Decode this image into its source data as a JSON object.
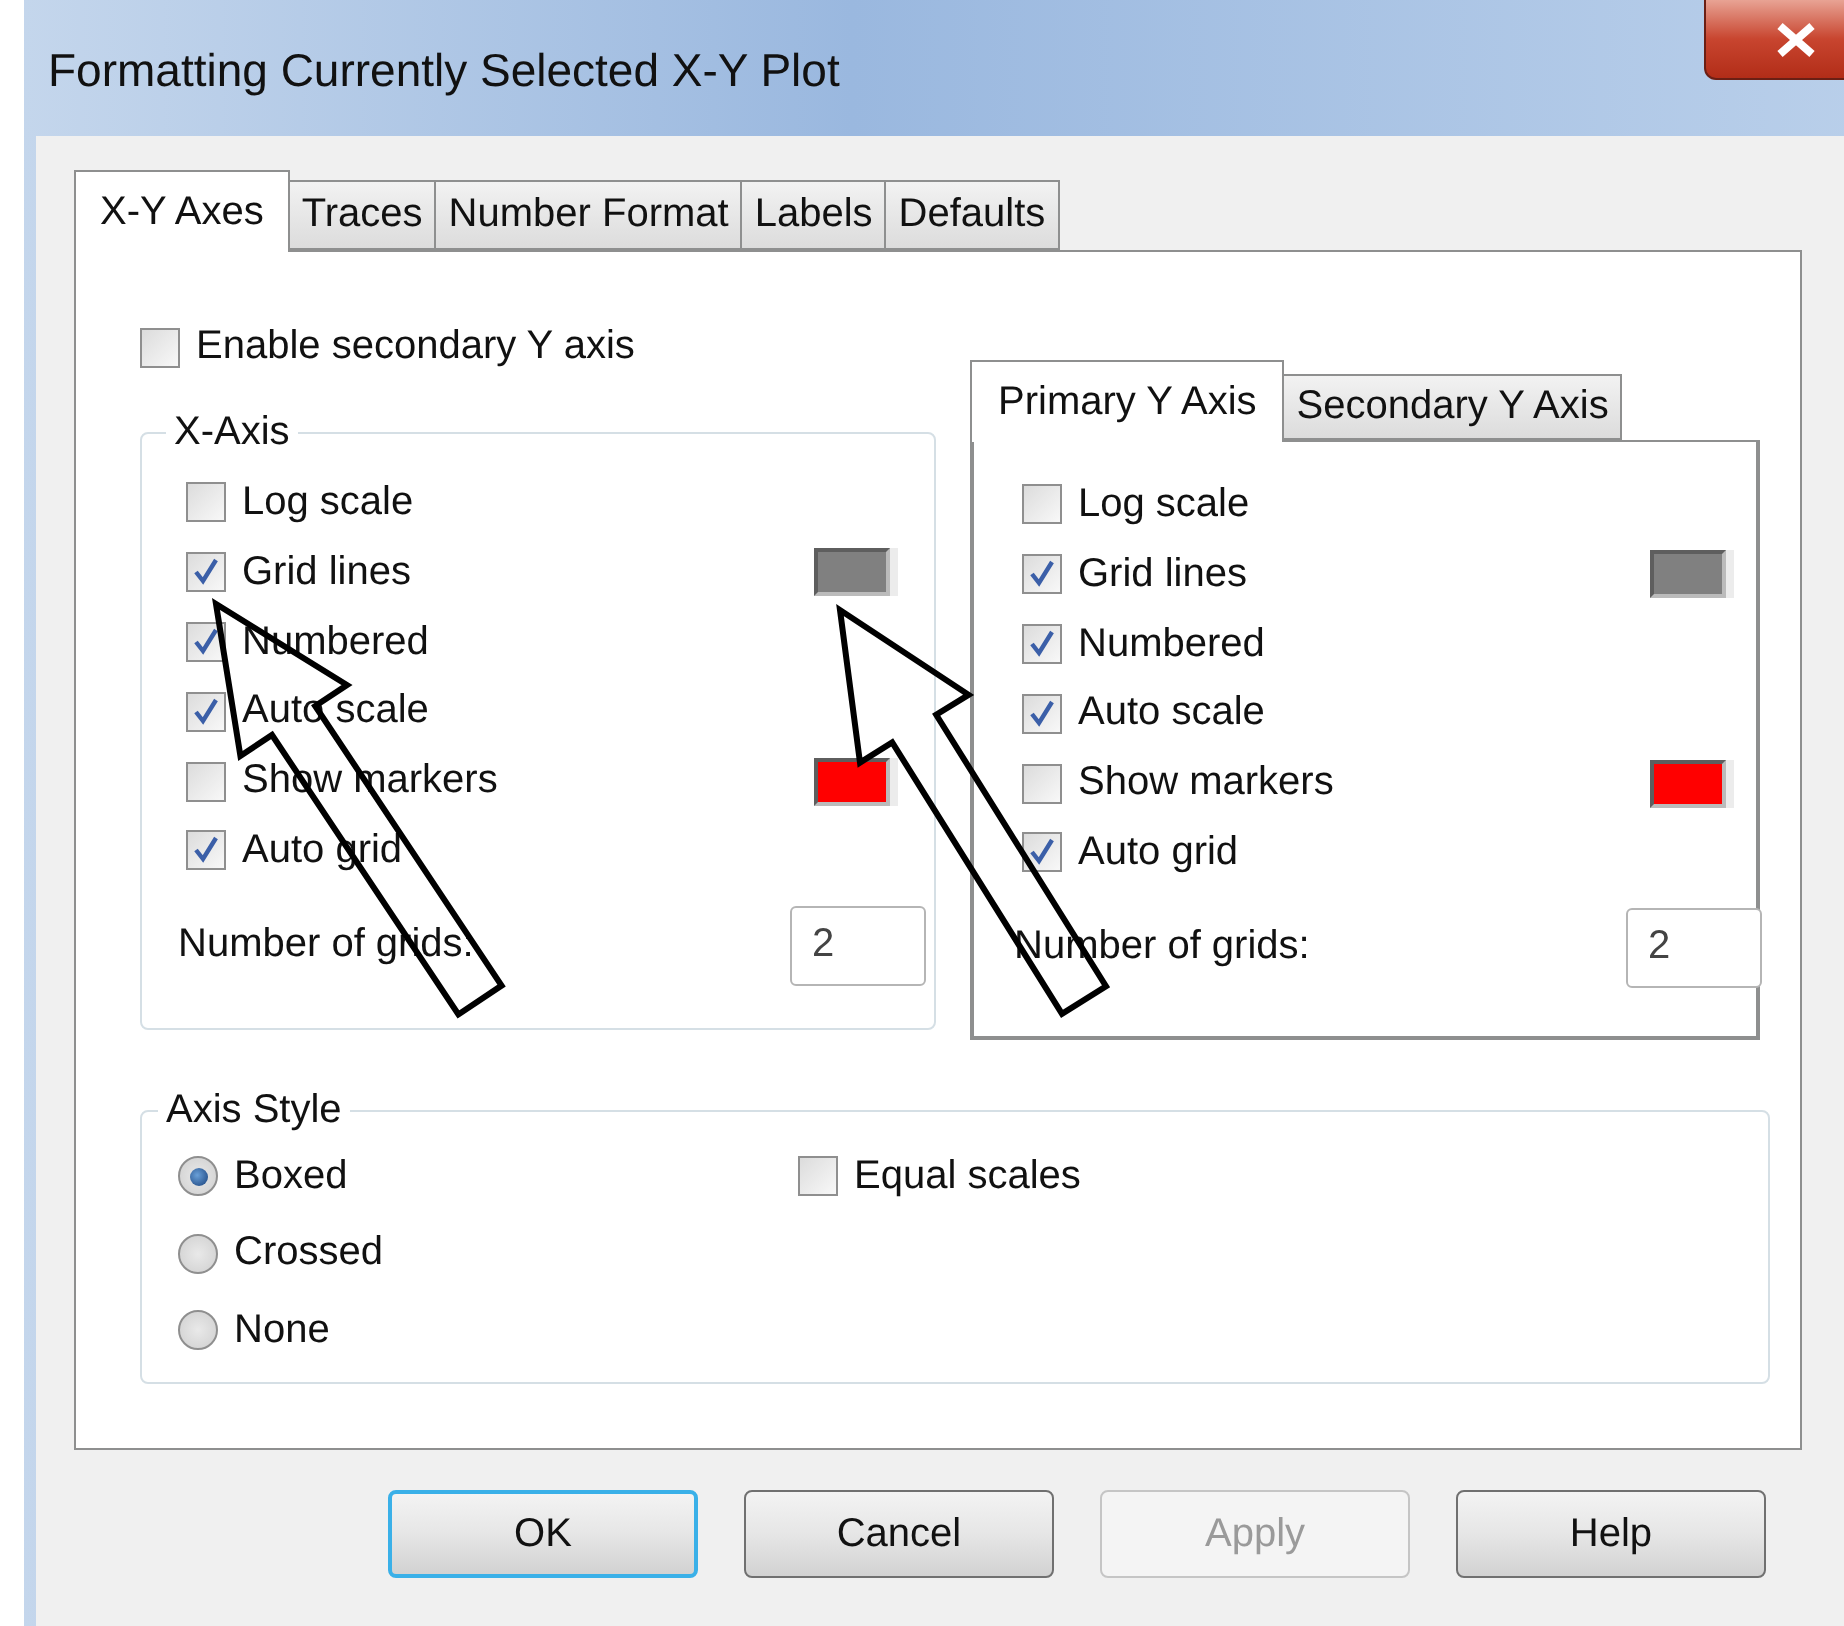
{
  "window": {
    "title": "Formatting Currently Selected X-Y Plot"
  },
  "tabs": [
    {
      "label": "X-Y Axes",
      "selected": true
    },
    {
      "label": "Traces",
      "selected": false
    },
    {
      "label": "Number Format",
      "selected": false
    },
    {
      "label": "Labels",
      "selected": false
    },
    {
      "label": "Defaults",
      "selected": false
    }
  ],
  "enable_secondary_y": {
    "label": "Enable secondary Y axis",
    "checked": false
  },
  "x_axis": {
    "title": "X-Axis",
    "options": [
      {
        "label": "Log scale",
        "checked": false
      },
      {
        "label": "Grid lines",
        "checked": true,
        "color": "#808080"
      },
      {
        "label": "Numbered",
        "checked": true
      },
      {
        "label": "Auto scale",
        "checked": true
      },
      {
        "label": "Show markers",
        "checked": false,
        "color": "#ff0000"
      },
      {
        "label": "Auto grid",
        "checked": true
      }
    ],
    "number_of_grids": {
      "label": "Number of grids:",
      "value": "2"
    }
  },
  "y_axis": {
    "tabs": [
      {
        "label": "Primary Y Axis",
        "selected": true
      },
      {
        "label": "Secondary Y Axis",
        "selected": false
      }
    ],
    "options": [
      {
        "label": "Log scale",
        "checked": false
      },
      {
        "label": "Grid lines",
        "checked": true,
        "color": "#808080"
      },
      {
        "label": "Numbered",
        "checked": true
      },
      {
        "label": "Auto scale",
        "checked": true
      },
      {
        "label": "Show markers",
        "checked": false,
        "color": "#ff0000"
      },
      {
        "label": "Auto grid",
        "checked": true
      }
    ],
    "number_of_grids": {
      "label": "Number of grids:",
      "value": "2"
    }
  },
  "axis_style": {
    "title": "Axis Style",
    "options": [
      {
        "label": "Boxed",
        "selected": true
      },
      {
        "label": "Crossed",
        "selected": false
      },
      {
        "label": "None",
        "selected": false
      }
    ],
    "equal_scales": {
      "label": "Equal scales",
      "checked": false
    }
  },
  "buttons": [
    {
      "label": "OK",
      "default": true,
      "disabled": false
    },
    {
      "label": "Cancel",
      "default": false,
      "disabled": false
    },
    {
      "label": "Apply",
      "default": false,
      "disabled": true
    },
    {
      "label": "Help",
      "default": false,
      "disabled": false
    }
  ]
}
